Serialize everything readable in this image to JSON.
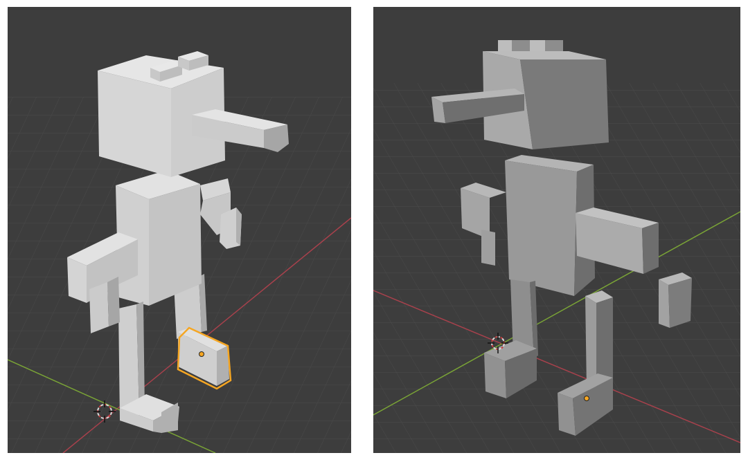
{
  "viewports": [
    {
      "id": "left",
      "selected_object": "foot-right",
      "selection_color": "#f5a623"
    },
    {
      "id": "right",
      "selected_object": null
    }
  ],
  "colors": {
    "background": "#3d3d3d",
    "grid": "#555555",
    "axis_x": "#a8414c",
    "axis_y": "#7aa436",
    "cube_top": "#dcdcdc",
    "cube_front": "#c9c9c9",
    "cube_side": "#a5a5a5"
  },
  "icons": [
    "3d-cursor-icon",
    "origin-dot-icon"
  ]
}
